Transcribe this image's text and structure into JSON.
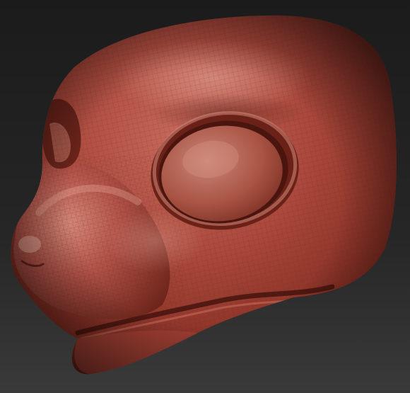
{
  "viewport": {
    "background_top": "#1b1b1b",
    "background_mid": "#262626",
    "background_bottom": "#3a3a3a"
  },
  "model": {
    "subject": "sculpted-creature-head-mesh",
    "material": {
      "base": "#a8473a",
      "highlight": "#e3a08f",
      "midtone": "#b8503f",
      "shadow": "#5c1c14",
      "deep_shadow": "#3a0f0a",
      "wire": "#6e2418"
    },
    "wireframe_visible": true
  }
}
